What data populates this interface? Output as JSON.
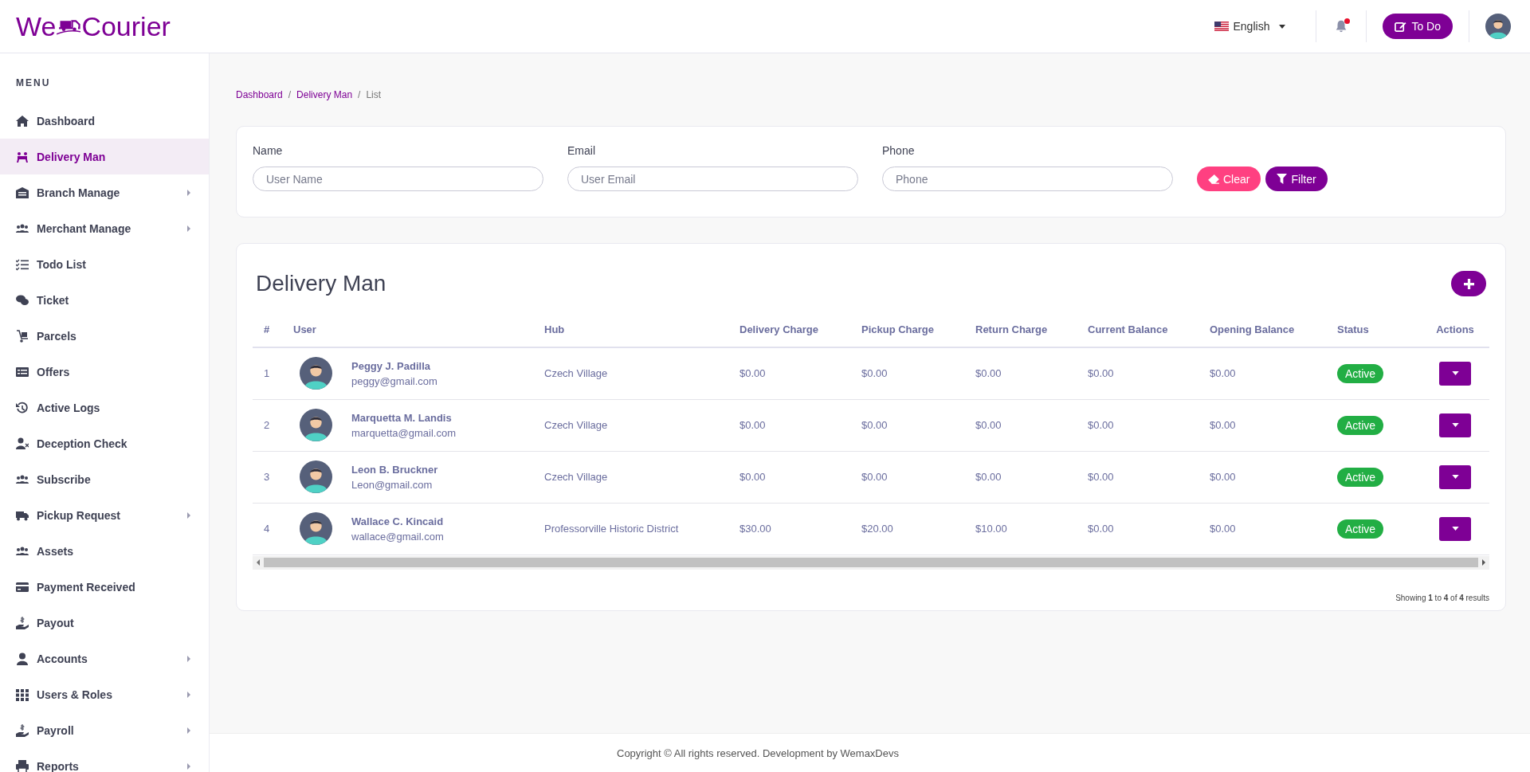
{
  "header": {
    "logo_left": "We",
    "logo_right": "Courier",
    "language": "English",
    "notification_unread": true,
    "todo_button": "To Do"
  },
  "sidebar": {
    "heading": "MENU",
    "items": [
      {
        "label": "Dashboard",
        "selected": false,
        "has_submenu": false
      },
      {
        "label": "Delivery Man",
        "selected": true,
        "has_submenu": false
      },
      {
        "label": "Branch Manage",
        "selected": false,
        "has_submenu": true
      },
      {
        "label": "Merchant Manage",
        "selected": false,
        "has_submenu": true
      },
      {
        "label": "Todo List",
        "selected": false,
        "has_submenu": false
      },
      {
        "label": "Ticket",
        "selected": false,
        "has_submenu": false
      },
      {
        "label": "Parcels",
        "selected": false,
        "has_submenu": false
      },
      {
        "label": "Offers",
        "selected": false,
        "has_submenu": false
      },
      {
        "label": "Active Logs",
        "selected": false,
        "has_submenu": false
      },
      {
        "label": "Deception Check",
        "selected": false,
        "has_submenu": false
      },
      {
        "label": "Subscribe",
        "selected": false,
        "has_submenu": false
      },
      {
        "label": "Pickup Request",
        "selected": false,
        "has_submenu": true
      },
      {
        "label": "Assets",
        "selected": false,
        "has_submenu": false
      },
      {
        "label": "Payment Received",
        "selected": false,
        "has_submenu": false
      },
      {
        "label": "Payout",
        "selected": false,
        "has_submenu": false
      },
      {
        "label": "Accounts",
        "selected": false,
        "has_submenu": true
      },
      {
        "label": "Users & Roles",
        "selected": false,
        "has_submenu": true
      },
      {
        "label": "Payroll",
        "selected": false,
        "has_submenu": true
      },
      {
        "label": "Reports",
        "selected": false,
        "has_submenu": true
      }
    ]
  },
  "breadcrumb": {
    "separator": "/",
    "items": [
      "Dashboard",
      "Delivery Man",
      "List"
    ]
  },
  "filter": {
    "fields": [
      {
        "label": "Name",
        "placeholder": "User Name"
      },
      {
        "label": "Email",
        "placeholder": "User Email"
      },
      {
        "label": "Phone",
        "placeholder": "Phone"
      }
    ],
    "clear_button": "Clear",
    "filter_button": "Filter"
  },
  "table": {
    "title": "Delivery Man",
    "columns": [
      "#",
      "User",
      "Hub",
      "Delivery Charge",
      "Pickup Charge",
      "Return Charge",
      "Current Balance",
      "Opening Balance",
      "Status",
      "Actions"
    ],
    "rows": [
      {
        "index": "1",
        "name": "Peggy J. Padilla",
        "email": "peggy@gmail.com",
        "hub": "Czech Village",
        "delivery_charge": "$0.00",
        "pickup_charge": "$0.00",
        "return_charge": "$0.00",
        "current_balance": "$0.00",
        "opening_balance": "$0.00",
        "status": "Active"
      },
      {
        "index": "2",
        "name": "Marquetta M. Landis",
        "email": "marquetta@gmail.com",
        "hub": "Czech Village",
        "delivery_charge": "$0.00",
        "pickup_charge": "$0.00",
        "return_charge": "$0.00",
        "current_balance": "$0.00",
        "opening_balance": "$0.00",
        "status": "Active"
      },
      {
        "index": "3",
        "name": "Leon B. Bruckner",
        "email": "Leon@gmail.com",
        "hub": "Czech Village",
        "delivery_charge": "$0.00",
        "pickup_charge": "$0.00",
        "return_charge": "$0.00",
        "current_balance": "$0.00",
        "opening_balance": "$0.00",
        "status": "Active"
      },
      {
        "index": "4",
        "name": "Wallace C. Kincaid",
        "email": "wallace@gmail.com",
        "hub": "Professorville Historic District",
        "delivery_charge": "$30.00",
        "pickup_charge": "$20.00",
        "return_charge": "$10.00",
        "current_balance": "$0.00",
        "opening_balance": "$0.00",
        "status": "Active"
      }
    ],
    "pagination": "Showing **1** to **4** of **4** results"
  },
  "footer": "Copyright © All rights reserved. Development by WemaxDevs"
}
